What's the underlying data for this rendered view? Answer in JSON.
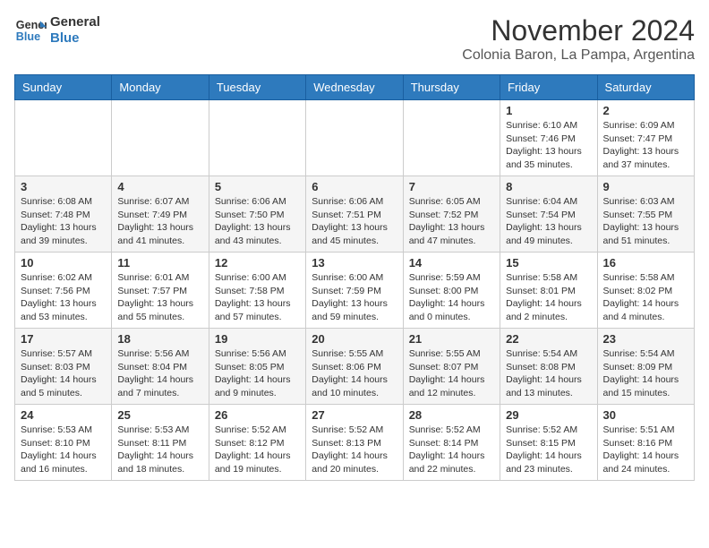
{
  "header": {
    "logo_line1": "General",
    "logo_line2": "Blue",
    "month": "November 2024",
    "location": "Colonia Baron, La Pampa, Argentina"
  },
  "weekdays": [
    "Sunday",
    "Monday",
    "Tuesday",
    "Wednesday",
    "Thursday",
    "Friday",
    "Saturday"
  ],
  "weeks": [
    [
      {
        "day": "",
        "info": ""
      },
      {
        "day": "",
        "info": ""
      },
      {
        "day": "",
        "info": ""
      },
      {
        "day": "",
        "info": ""
      },
      {
        "day": "",
        "info": ""
      },
      {
        "day": "1",
        "info": "Sunrise: 6:10 AM\nSunset: 7:46 PM\nDaylight: 13 hours\nand 35 minutes."
      },
      {
        "day": "2",
        "info": "Sunrise: 6:09 AM\nSunset: 7:47 PM\nDaylight: 13 hours\nand 37 minutes."
      }
    ],
    [
      {
        "day": "3",
        "info": "Sunrise: 6:08 AM\nSunset: 7:48 PM\nDaylight: 13 hours\nand 39 minutes."
      },
      {
        "day": "4",
        "info": "Sunrise: 6:07 AM\nSunset: 7:49 PM\nDaylight: 13 hours\nand 41 minutes."
      },
      {
        "day": "5",
        "info": "Sunrise: 6:06 AM\nSunset: 7:50 PM\nDaylight: 13 hours\nand 43 minutes."
      },
      {
        "day": "6",
        "info": "Sunrise: 6:06 AM\nSunset: 7:51 PM\nDaylight: 13 hours\nand 45 minutes."
      },
      {
        "day": "7",
        "info": "Sunrise: 6:05 AM\nSunset: 7:52 PM\nDaylight: 13 hours\nand 47 minutes."
      },
      {
        "day": "8",
        "info": "Sunrise: 6:04 AM\nSunset: 7:54 PM\nDaylight: 13 hours\nand 49 minutes."
      },
      {
        "day": "9",
        "info": "Sunrise: 6:03 AM\nSunset: 7:55 PM\nDaylight: 13 hours\nand 51 minutes."
      }
    ],
    [
      {
        "day": "10",
        "info": "Sunrise: 6:02 AM\nSunset: 7:56 PM\nDaylight: 13 hours\nand 53 minutes."
      },
      {
        "day": "11",
        "info": "Sunrise: 6:01 AM\nSunset: 7:57 PM\nDaylight: 13 hours\nand 55 minutes."
      },
      {
        "day": "12",
        "info": "Sunrise: 6:00 AM\nSunset: 7:58 PM\nDaylight: 13 hours\nand 57 minutes."
      },
      {
        "day": "13",
        "info": "Sunrise: 6:00 AM\nSunset: 7:59 PM\nDaylight: 13 hours\nand 59 minutes."
      },
      {
        "day": "14",
        "info": "Sunrise: 5:59 AM\nSunset: 8:00 PM\nDaylight: 14 hours\nand 0 minutes."
      },
      {
        "day": "15",
        "info": "Sunrise: 5:58 AM\nSunset: 8:01 PM\nDaylight: 14 hours\nand 2 minutes."
      },
      {
        "day": "16",
        "info": "Sunrise: 5:58 AM\nSunset: 8:02 PM\nDaylight: 14 hours\nand 4 minutes."
      }
    ],
    [
      {
        "day": "17",
        "info": "Sunrise: 5:57 AM\nSunset: 8:03 PM\nDaylight: 14 hours\nand 5 minutes."
      },
      {
        "day": "18",
        "info": "Sunrise: 5:56 AM\nSunset: 8:04 PM\nDaylight: 14 hours\nand 7 minutes."
      },
      {
        "day": "19",
        "info": "Sunrise: 5:56 AM\nSunset: 8:05 PM\nDaylight: 14 hours\nand 9 minutes."
      },
      {
        "day": "20",
        "info": "Sunrise: 5:55 AM\nSunset: 8:06 PM\nDaylight: 14 hours\nand 10 minutes."
      },
      {
        "day": "21",
        "info": "Sunrise: 5:55 AM\nSunset: 8:07 PM\nDaylight: 14 hours\nand 12 minutes."
      },
      {
        "day": "22",
        "info": "Sunrise: 5:54 AM\nSunset: 8:08 PM\nDaylight: 14 hours\nand 13 minutes."
      },
      {
        "day": "23",
        "info": "Sunrise: 5:54 AM\nSunset: 8:09 PM\nDaylight: 14 hours\nand 15 minutes."
      }
    ],
    [
      {
        "day": "24",
        "info": "Sunrise: 5:53 AM\nSunset: 8:10 PM\nDaylight: 14 hours\nand 16 minutes."
      },
      {
        "day": "25",
        "info": "Sunrise: 5:53 AM\nSunset: 8:11 PM\nDaylight: 14 hours\nand 18 minutes."
      },
      {
        "day": "26",
        "info": "Sunrise: 5:52 AM\nSunset: 8:12 PM\nDaylight: 14 hours\nand 19 minutes."
      },
      {
        "day": "27",
        "info": "Sunrise: 5:52 AM\nSunset: 8:13 PM\nDaylight: 14 hours\nand 20 minutes."
      },
      {
        "day": "28",
        "info": "Sunrise: 5:52 AM\nSunset: 8:14 PM\nDaylight: 14 hours\nand 22 minutes."
      },
      {
        "day": "29",
        "info": "Sunrise: 5:52 AM\nSunset: 8:15 PM\nDaylight: 14 hours\nand 23 minutes."
      },
      {
        "day": "30",
        "info": "Sunrise: 5:51 AM\nSunset: 8:16 PM\nDaylight: 14 hours\nand 24 minutes."
      }
    ]
  ]
}
